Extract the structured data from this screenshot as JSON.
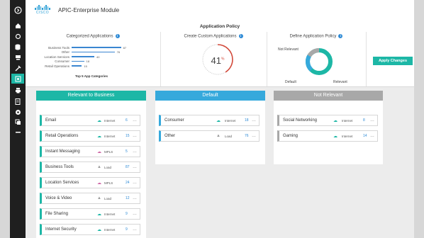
{
  "app": {
    "title": "APIC-Enterprise Module",
    "logo_text": "CISCO"
  },
  "policy": {
    "title": "Application Policy"
  },
  "categorized": {
    "title": "Categorized Applications",
    "footer": "Top 5 App Categories",
    "items": [
      {
        "label": "Business Tools",
        "value": "87",
        "fraction": 0.87
      },
      {
        "label": "Other",
        "value": "76",
        "fraction": 0.76
      },
      {
        "label": "Location Services",
        "value": "40",
        "fraction": 0.4
      },
      {
        "label": "Consumer",
        "value": "18",
        "fraction": 0.22
      },
      {
        "label": "Retail Operations",
        "value": "15",
        "fraction": 0.18
      }
    ]
  },
  "custom": {
    "title": "Create Custom Applications",
    "percent": "41",
    "unit": "%",
    "fraction": 0.41
  },
  "define": {
    "title": "Define Application Policy",
    "labels": {
      "not_relevant": "Not Relevant",
      "default": "Default",
      "relevant": "Relevant"
    }
  },
  "apply_button": "Apply Changes",
  "colors": {
    "accent": "#1db7a6",
    "default": "#36a9dc",
    "not_relevant": "#a8a8a8",
    "link": "#2f8bd6"
  },
  "columns": [
    {
      "header": "Relevant to Business",
      "cards": [
        {
          "name": "Email",
          "link": "Internet",
          "count": "6"
        },
        {
          "name": "Retail Operations",
          "link": "Internet",
          "count": "15"
        },
        {
          "name": "Instant Messaging",
          "link": "MPLS",
          "count": "5"
        },
        {
          "name": "Business Tools",
          "link": "Load",
          "count": "87"
        },
        {
          "name": "Location Services",
          "link": "MPLS",
          "count": "24"
        },
        {
          "name": "Voice & Video",
          "link": "Load",
          "count": "12"
        },
        {
          "name": "File Sharing",
          "link": "Internet",
          "count": "9"
        },
        {
          "name": "Internet Security",
          "link": "Internet",
          "count": "9"
        }
      ]
    },
    {
      "header": "Default",
      "cards": [
        {
          "name": "Consumer",
          "link": "Internet",
          "count": "18"
        },
        {
          "name": "Other",
          "link": "Load",
          "count": "76"
        }
      ]
    },
    {
      "header": "Not Relevant",
      "cards": [
        {
          "name": "Social Networking",
          "link": "Internet",
          "count": "8"
        },
        {
          "name": "Gaming",
          "link": "Internet",
          "count": "14"
        }
      ]
    }
  ]
}
